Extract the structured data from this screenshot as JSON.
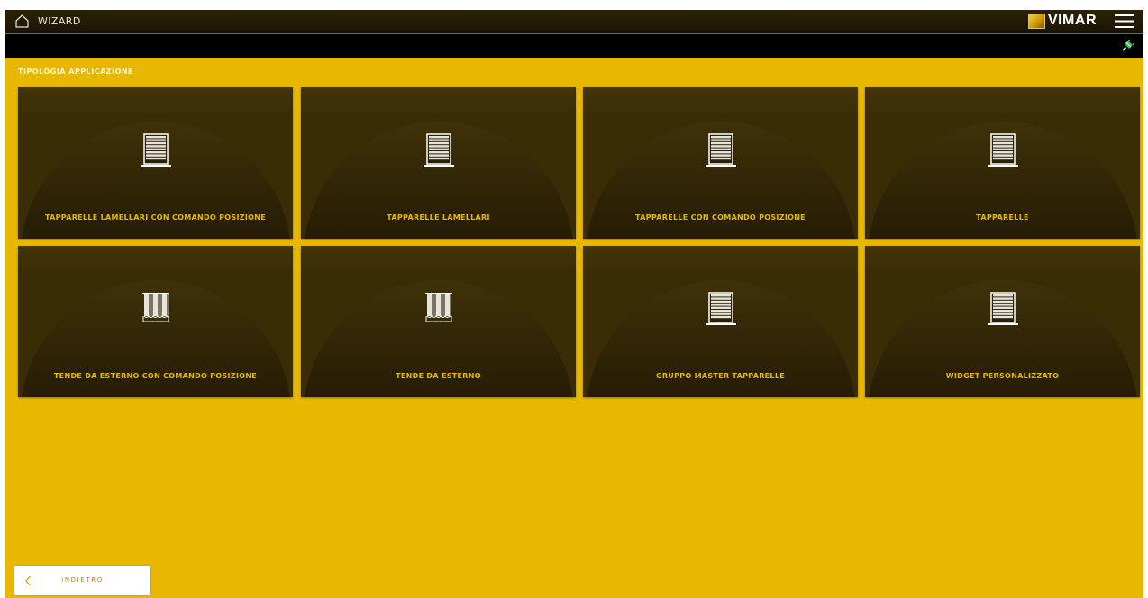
{
  "header": {
    "title": "WIZARD",
    "brand": "VIMAR",
    "home_icon": "home-icon",
    "menu_icon": "hamburger-menu-icon",
    "status_icon": "plug-connection-icon"
  },
  "section_title": "TIPOLOGIA APPLICAZIONE",
  "cards": [
    {
      "label": "TAPPARELLE LAMELLARI CON COMANDO POSIZIONE",
      "icon": "shutter-icon"
    },
    {
      "label": "TAPPARELLE LAMELLARI",
      "icon": "shutter-icon"
    },
    {
      "label": "TAPPARELLE CON COMANDO POSIZIONE",
      "icon": "shutter-icon"
    },
    {
      "label": "TAPPARELLE",
      "icon": "shutter-icon"
    },
    {
      "label": "TENDE DA ESTERNO CON COMANDO POSIZIONE",
      "icon": "awning-icon"
    },
    {
      "label": "TENDE DA ESTERNO",
      "icon": "awning-icon"
    },
    {
      "label": "GRUPPO MASTER TAPPARELLE",
      "icon": "shutter-icon"
    },
    {
      "label": "WIDGET PERSONALIZZATO",
      "icon": "shutter-icon"
    }
  ],
  "back_button": {
    "label": "INDIETRO",
    "icon": "chevron-left-icon"
  },
  "colors": {
    "background": "#e8b800",
    "card": "#3a2d06",
    "card_label": "#e8b800",
    "header": "#1a1405"
  }
}
